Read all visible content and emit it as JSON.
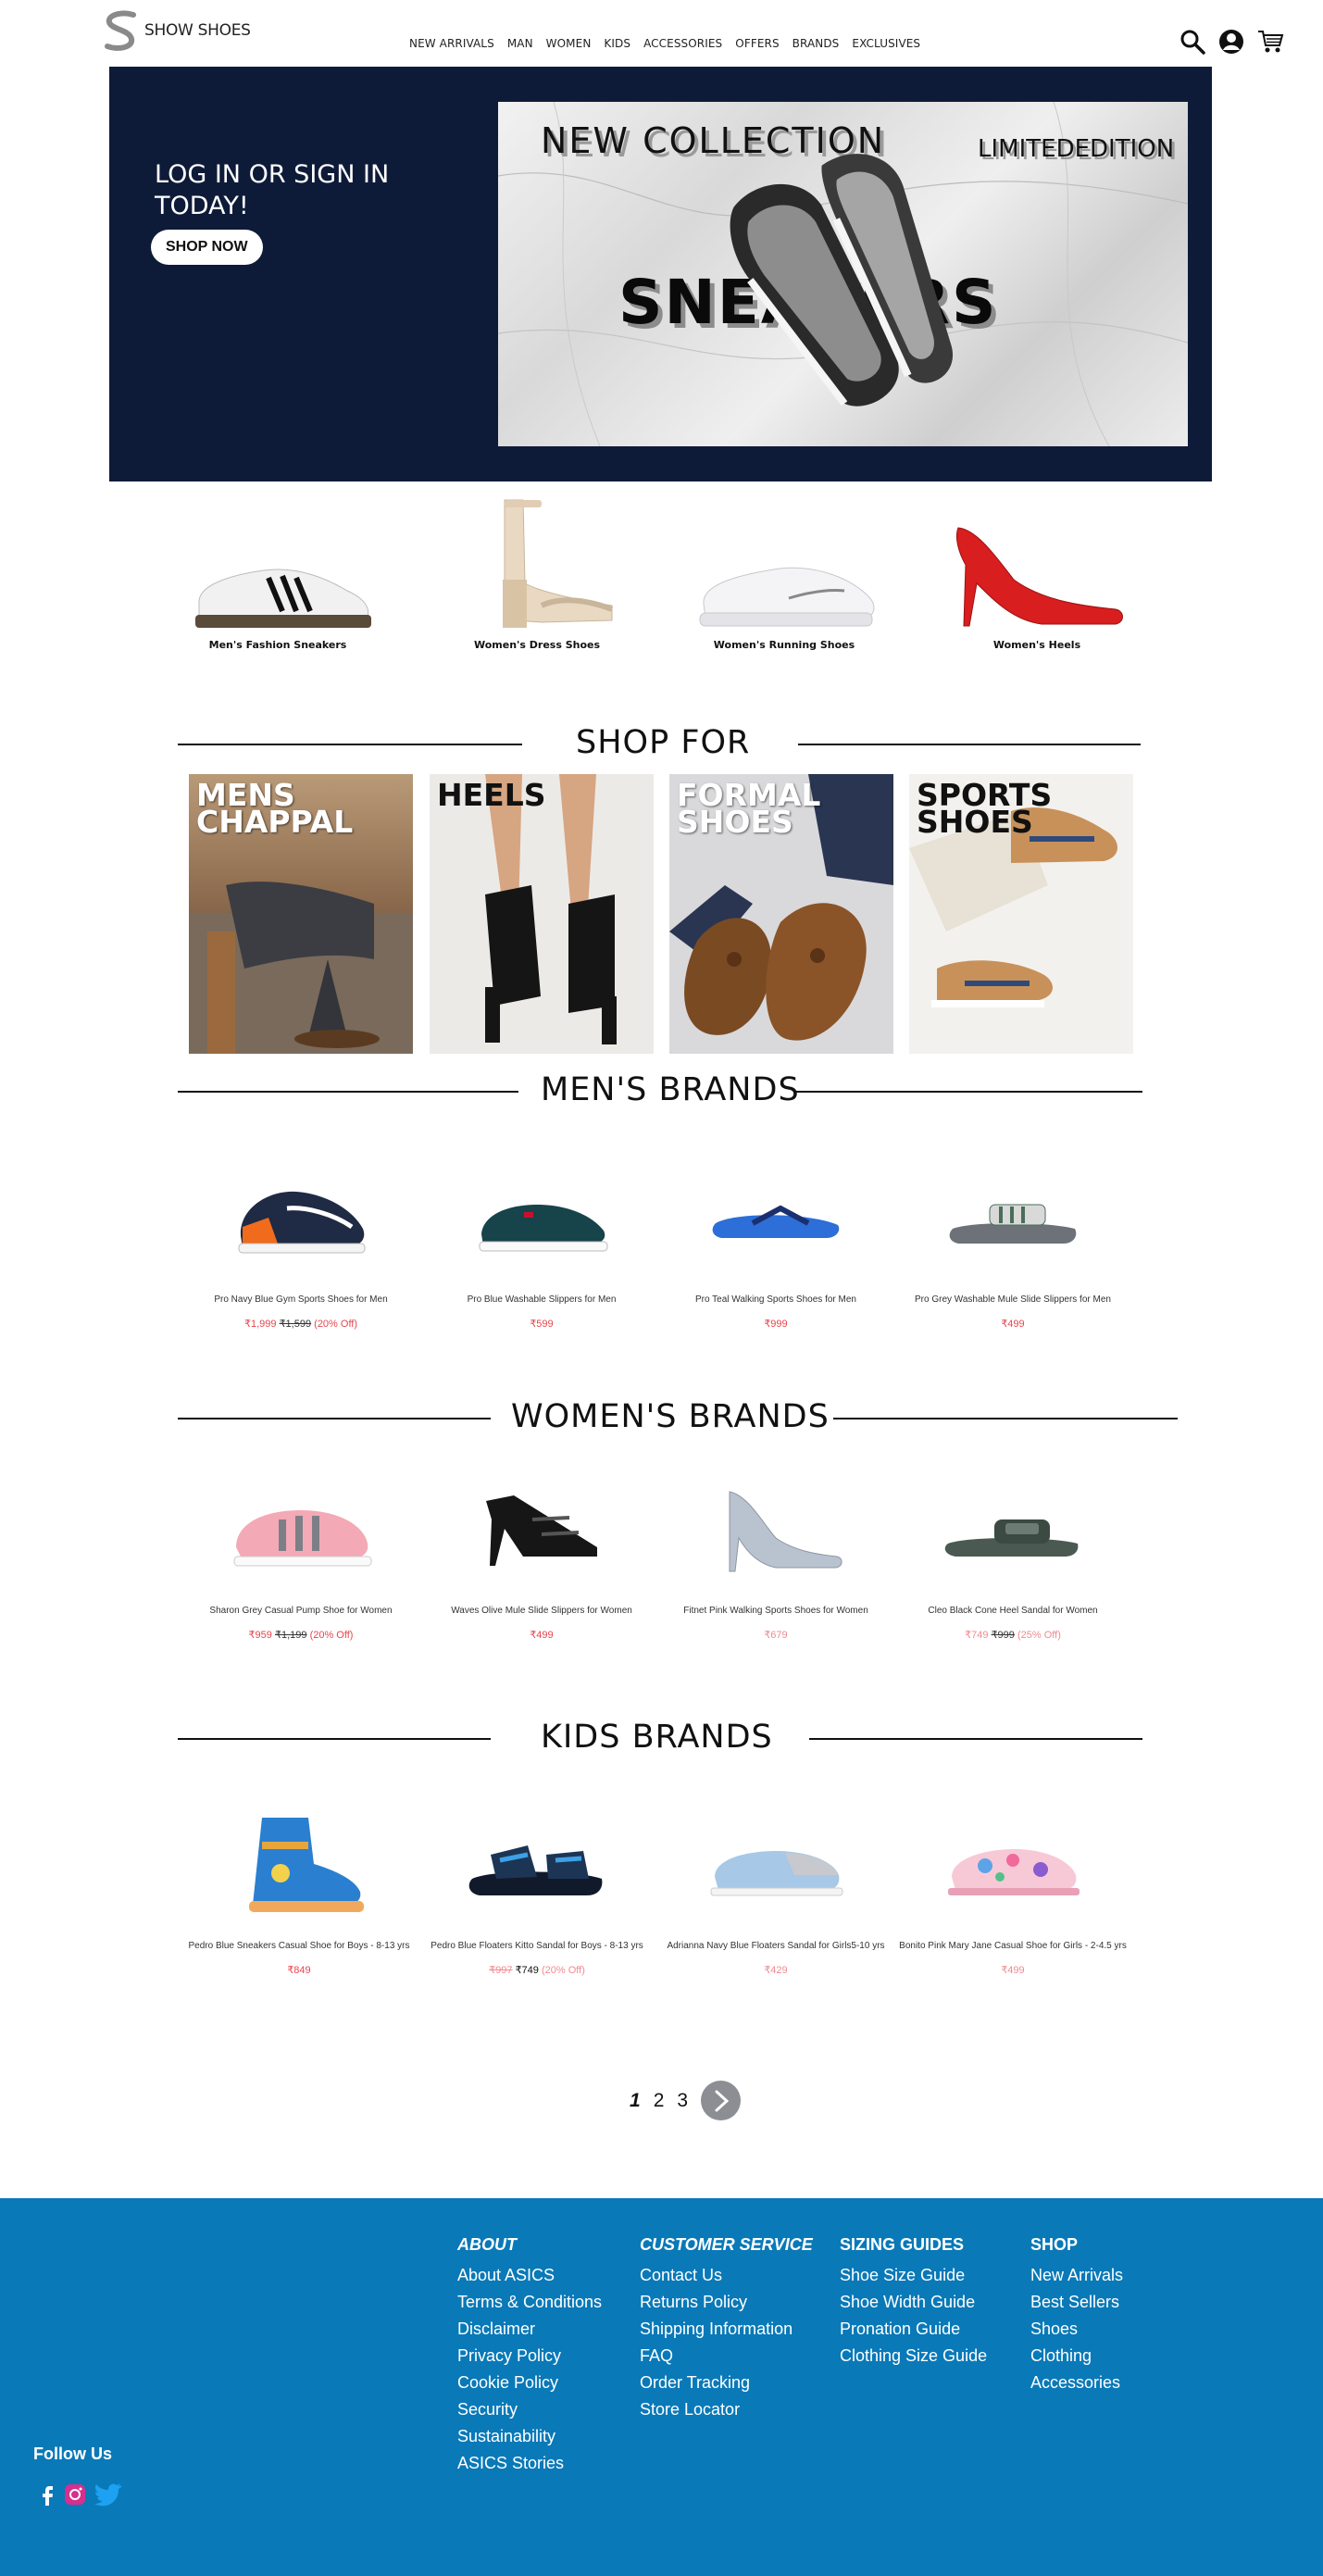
{
  "brand": {
    "name": "SHOW SHOES"
  },
  "nav": [
    "NEW ARRIVALS",
    "MAN",
    "WOMEN",
    "KIDS",
    "ACCESSORIES",
    "OFFERS",
    "BRANDS",
    "EXCLUSIVES"
  ],
  "hero": {
    "title": "LOG IN OR SIGN IN TODAY!",
    "cta": "SHOP NOW",
    "banner_new": "NEW  COLLECTION",
    "banner_limited": "LIMITEDEDITION",
    "banner_sneakers": "SNEAKERS"
  },
  "categories": [
    "Men's Fashion Sneakers",
    "Women's Dress Shoes",
    "Women's Running Shoes",
    "Women's Heels"
  ],
  "shop_for": {
    "title": "SHOP FOR",
    "tiles": [
      "MENS CHAPPAL",
      "HEELS",
      "FORMAL SHOES",
      "SPORTS SHOES"
    ]
  },
  "mens": {
    "title": "MEN'S BRANDS",
    "products": [
      {
        "name": "Pro Navy Blue Gym Sports Shoes for Men",
        "price": "₹1,999",
        "old": "₹1,599",
        "off": "(20% Off)"
      },
      {
        "name": "Pro Blue Washable Slippers for Men",
        "price": "₹599"
      },
      {
        "name": "Pro Teal Walking Sports Shoes for Men",
        "price": "₹999"
      },
      {
        "name": "Pro Grey Washable Mule Slide Slippers for Men",
        "price": "₹499"
      }
    ]
  },
  "womens": {
    "title": "WOMEN'S BRANDS",
    "products": [
      {
        "name": "Sharon Grey Casual Pump Shoe for Women",
        "price": "₹959",
        "old": "₹1,199",
        "off": "(20% Off)"
      },
      {
        "name": "Waves Olive  Mule Slide Slippers for Women",
        "price": "₹499"
      },
      {
        "name": "Fitnet Pink Walking Sports Shoes for Women",
        "price": "₹679"
      },
      {
        "name": "Cleo Black Cone Heel Sandal for Women",
        "price": "₹749",
        "old": "₹999",
        "off": "(25% Off)"
      }
    ]
  },
  "kids": {
    "title": "KIDS BRANDS",
    "products": [
      {
        "name": "Pedro Blue Sneakers Casual Shoe for Boys - 8-13 yrs",
        "price": "₹849"
      },
      {
        "name": "Pedro Blue Floaters Kitto Sandal for Boys - 8-13 yrs",
        "old": "₹997",
        "price": "₹749",
        "off": "(20% Off)"
      },
      {
        "name": "Adrianna Navy Blue Floaters Sandal for Girls5-10 yrs",
        "price": "₹429"
      },
      {
        "name": "Bonito Pink Mary Jane Casual Shoe for Girls - 2-4.5 yrs",
        "price": "₹499"
      }
    ]
  },
  "pagination": {
    "pages": [
      "1",
      "2",
      "3"
    ],
    "current": "1"
  },
  "footer": {
    "about": {
      "title": "ABOUT",
      "links": [
        "About ASICS",
        "Terms & Conditions",
        "Disclaimer",
        "Privacy Policy",
        "Cookie Policy",
        "Security",
        "Sustainability",
        "ASICS Stories"
      ]
    },
    "service": {
      "title": "CUSTOMER SERVICE",
      "links": [
        "Contact Us",
        "Returns Policy",
        "Shipping Information",
        "FAQ",
        "Order Tracking",
        "Store Locator"
      ]
    },
    "sizing": {
      "title": "SIZING GUIDES",
      "links": [
        "Shoe Size Guide",
        "Shoe Width Guide",
        "Pronation Guide",
        "Clothing Size Guide"
      ]
    },
    "shop": {
      "title": "SHOP",
      "links": [
        "New Arrivals",
        "Best Sellers",
        "Shoes",
        "Clothing",
        "Accessories"
      ]
    },
    "follow": "Follow Us"
  },
  "colors": {
    "hero_bg": "#0e1b38",
    "footer_bg": "#0979b8",
    "price_red": "#e8454d"
  }
}
